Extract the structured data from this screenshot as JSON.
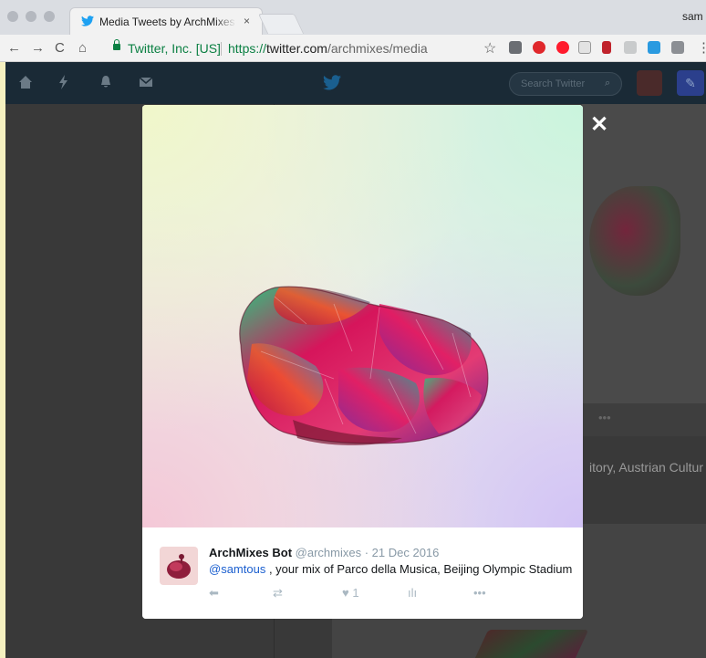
{
  "browser": {
    "tab_title": "Media Tweets by ArchMixes Bot",
    "tab_close": "×",
    "profile_name": "sam",
    "nav": {
      "back": "←",
      "forward": "→",
      "reload": "C",
      "home": "⌂"
    },
    "security_org": "Twitter, Inc. [US]",
    "url_scheme": "https://",
    "url_host": "twitter.com",
    "url_path": "/archmixes/media",
    "bookmark_star": "☆",
    "menu": "⋮"
  },
  "twitter_nav": {
    "search_placeholder": "Search Twitter",
    "search_icon": "⌕",
    "compose_icon": "✎"
  },
  "background": {
    "more_dots": "•••",
    "caption": "itory, Austrian Cultur"
  },
  "modal": {
    "close_label": "✕",
    "tweet": {
      "author_name": "ArchMixes Bot",
      "author_handle": "@archmixes",
      "separator": " · ",
      "date": "21 Dec 2016",
      "mention": "@samtous",
      "text": " , your mix of Parco della Musica, Beijing Olympic Stadium",
      "actions": {
        "reply_icon": "⬅",
        "retweet_icon": "⇄",
        "like_icon": "♥",
        "like_count": "1",
        "analytics_icon": "ılı",
        "more_icon": "•••"
      }
    }
  },
  "colors": {
    "twitter_blue": "#1da1f2",
    "secure_green": "#0b8043",
    "mention_blue": "#1b5fcf"
  }
}
